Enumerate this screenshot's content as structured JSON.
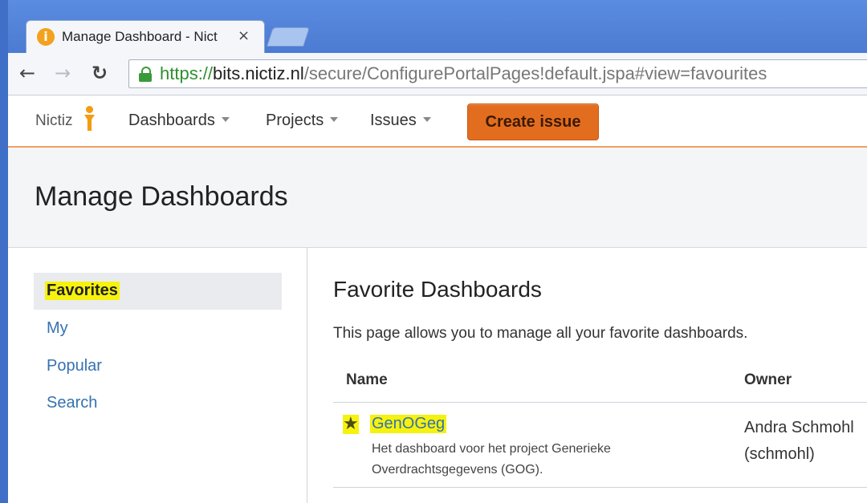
{
  "browser": {
    "tab_title": "Manage Dashboard - Nict",
    "tab_close": "×",
    "url_scheme": "https://",
    "url_host": "bits.nictiz.nl",
    "url_path": "/secure/ConfigurePortalPages!default.jspa#view=favourites",
    "back": "←",
    "forward": "→",
    "reload": "C"
  },
  "header": {
    "logo_text": "Nictiz",
    "nav": [
      {
        "label": "Dashboards"
      },
      {
        "label": "Projects"
      },
      {
        "label": "Issues"
      }
    ],
    "create_label": "Create issue",
    "accent": "#e36d1f"
  },
  "page": {
    "title": "Manage Dashboards"
  },
  "sidebar": {
    "items": [
      {
        "label": "Favorites",
        "active": true
      },
      {
        "label": "My"
      },
      {
        "label": "Popular"
      },
      {
        "label": "Search"
      }
    ]
  },
  "main": {
    "section_title": "Favorite Dashboards",
    "description": "This page allows you to manage all your favorite dashboards.",
    "columns": [
      "Name",
      "Owner"
    ],
    "rows": [
      {
        "name": "GenOGeg",
        "description": "Het dashboard voor het project Generieke Overdrachtsgegevens (GOG).",
        "owner": "Andra Schmohl (schmohl)",
        "icon": "star-icon"
      }
    ]
  },
  "colors": {
    "link": "#3572b0",
    "highlight": "#f6f20d",
    "chrome_blue": "#4b7bd2"
  }
}
